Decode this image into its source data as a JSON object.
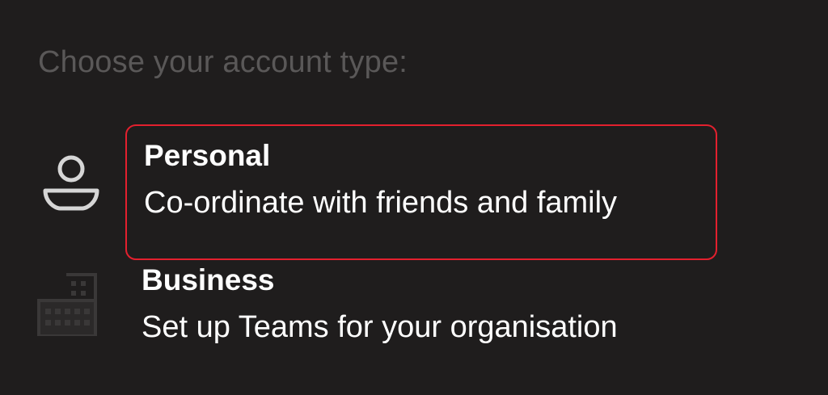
{
  "header": {
    "prompt": "Choose your account type:"
  },
  "options": [
    {
      "title": "Personal",
      "subtitle": "Co-ordinate with friends and family",
      "icon": "person-icon",
      "selected": true
    },
    {
      "title": "Business",
      "subtitle": "Set up Teams for your organisation",
      "icon": "building-icon",
      "selected": false
    }
  ],
  "colors": {
    "background": "#1f1d1d",
    "prompt_text": "#5a5858",
    "option_text": "#ffffff",
    "highlight_border": "#e3202e",
    "personal_icon": "#d6d6d6",
    "business_icon": "#3a3838"
  }
}
